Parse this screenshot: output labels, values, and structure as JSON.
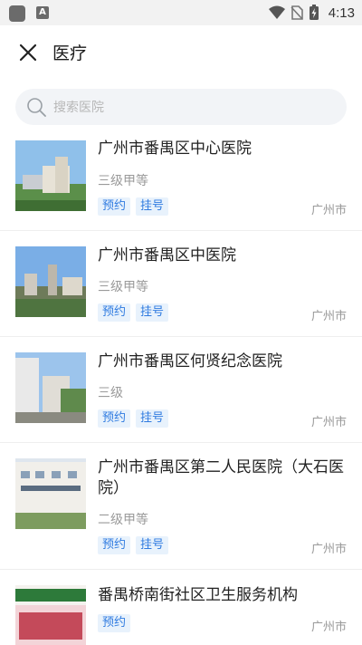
{
  "status_bar": {
    "time": "4:13",
    "a_badge": "A"
  },
  "header": {
    "title": "医疗"
  },
  "search": {
    "placeholder": "搜索医院"
  },
  "hospitals": [
    {
      "name": "广州市番禺区中心医院",
      "level": "三级甲等",
      "tags": [
        "预约",
        "挂号"
      ],
      "city": "广州市"
    },
    {
      "name": "广州市番禺区中医院",
      "level": "三级甲等",
      "tags": [
        "预约",
        "挂号"
      ],
      "city": "广州市"
    },
    {
      "name": "广州市番禺区何贤纪念医院",
      "level": "三级",
      "tags": [
        "预约",
        "挂号"
      ],
      "city": "广州市"
    },
    {
      "name": "广州市番禺区第二人民医院（大石医院）",
      "level": "二级甲等",
      "tags": [
        "预约",
        "挂号"
      ],
      "city": "广州市"
    },
    {
      "name": "番禺桥南街社区卫生服务机构",
      "level": "",
      "tags": [
        "预约"
      ],
      "city": "广州市"
    }
  ]
}
